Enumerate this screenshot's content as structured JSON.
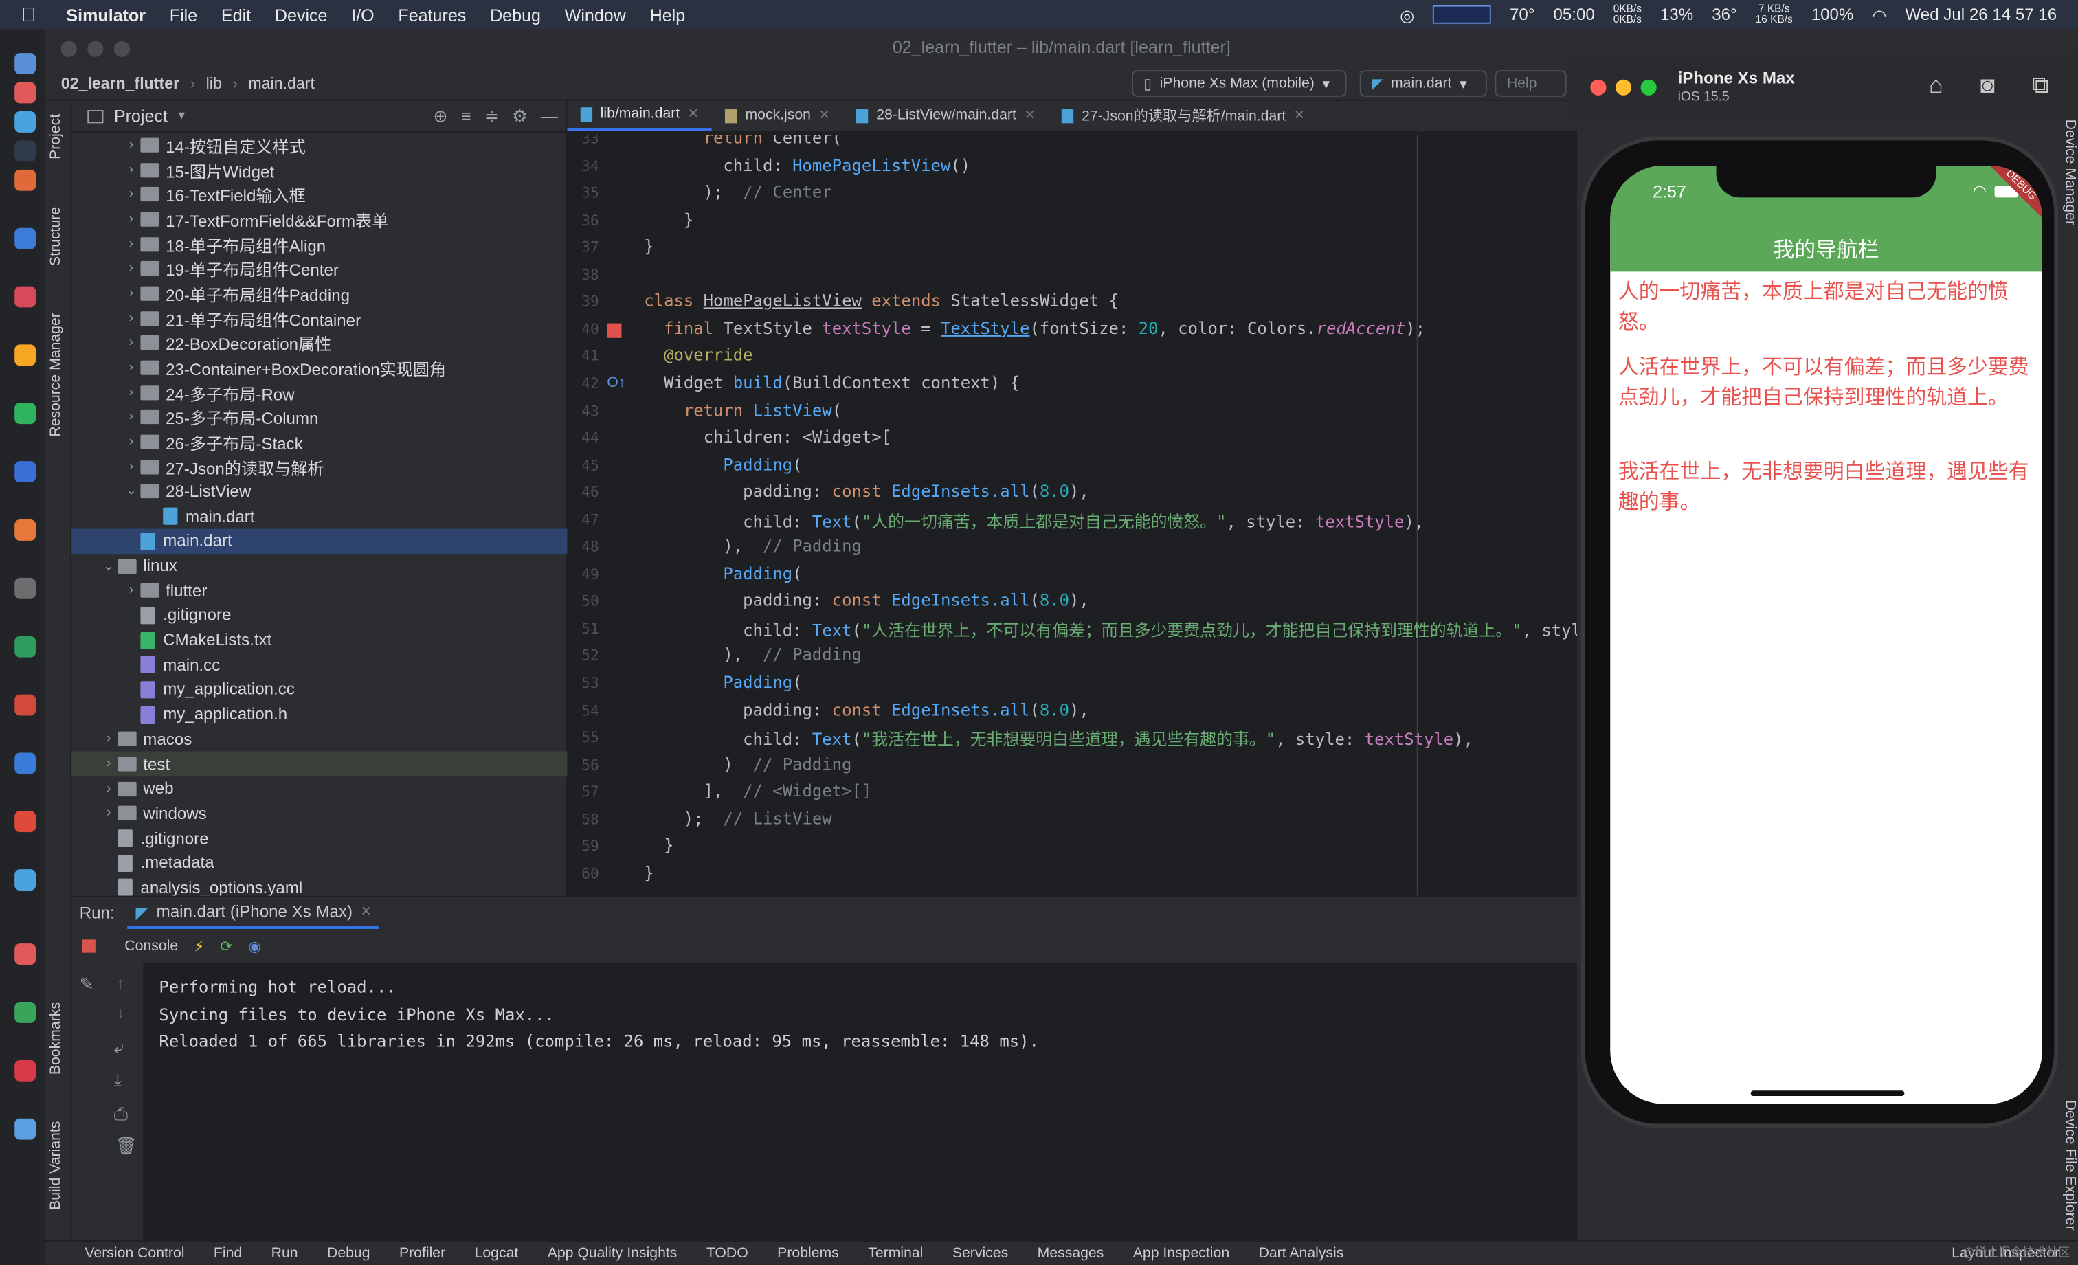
{
  "menubar": {
    "app": "Simulator",
    "items": [
      "File",
      "Edit",
      "Device",
      "I/O",
      "Features",
      "Debug",
      "Window",
      "Help"
    ],
    "weather": "70°",
    "clock_small": "05:00",
    "net_down": "0KB/s",
    "net_up": "0KB/s",
    "cpu": "13%",
    "temp": "36°",
    "net2_down": "7 KB/s",
    "net2_up": "16 KB/s",
    "battery": "100%",
    "datetime": "Wed Jul 26  14 57 16"
  },
  "ide": {
    "window_title": "02_learn_flutter – lib/main.dart [learn_flutter]",
    "breadcrumb": [
      "02_learn_flutter",
      "lib",
      "main.dart"
    ],
    "device_selector": "iPhone Xs Max (mobile)",
    "run_config": "main.dart",
    "help_label": "Help",
    "left_tabs": [
      "Project",
      "Structure",
      "Resource Manager",
      "Bookmarks",
      "Build Variants"
    ]
  },
  "project": {
    "header": "Project",
    "rows": [
      {
        "indent": 2,
        "chev": "›",
        "icon": "folder",
        "label": "14-按钮自定义样式"
      },
      {
        "indent": 2,
        "chev": "›",
        "icon": "folder",
        "label": "15-图片Widget"
      },
      {
        "indent": 2,
        "chev": "›",
        "icon": "folder",
        "label": "16-TextField输入框"
      },
      {
        "indent": 2,
        "chev": "›",
        "icon": "folder",
        "label": "17-TextFormField&&Form表单"
      },
      {
        "indent": 2,
        "chev": "›",
        "icon": "folder",
        "label": "18-单子布局组件Align"
      },
      {
        "indent": 2,
        "chev": "›",
        "icon": "folder",
        "label": "19-单子布局组件Center"
      },
      {
        "indent": 2,
        "chev": "›",
        "icon": "folder",
        "label": "20-单子布局组件Padding"
      },
      {
        "indent": 2,
        "chev": "›",
        "icon": "folder",
        "label": "21-单子布局组件Container"
      },
      {
        "indent": 2,
        "chev": "›",
        "icon": "folder",
        "label": "22-BoxDecoration属性"
      },
      {
        "indent": 2,
        "chev": "›",
        "icon": "folder",
        "label": "23-Container+BoxDecoration实现圆角"
      },
      {
        "indent": 2,
        "chev": "›",
        "icon": "folder",
        "label": "24-多子布局-Row"
      },
      {
        "indent": 2,
        "chev": "›",
        "icon": "folder",
        "label": "25-多子布局-Column"
      },
      {
        "indent": 2,
        "chev": "›",
        "icon": "folder",
        "label": "26-多子布局-Stack"
      },
      {
        "indent": 2,
        "chev": "›",
        "icon": "folder",
        "label": "27-Json的读取与解析"
      },
      {
        "indent": 2,
        "chev": "⌄",
        "icon": "folder",
        "label": "28-ListView"
      },
      {
        "indent": 3,
        "chev": "",
        "icon": "dart",
        "label": "main.dart"
      },
      {
        "indent": 2,
        "chev": "",
        "icon": "dart",
        "label": "main.dart",
        "selected": true
      },
      {
        "indent": 1,
        "chev": "⌄",
        "icon": "folder",
        "label": "linux"
      },
      {
        "indent": 2,
        "chev": "›",
        "icon": "folder",
        "label": "flutter"
      },
      {
        "indent": 2,
        "chev": "",
        "icon": "gen",
        "label": ".gitignore"
      },
      {
        "indent": 2,
        "chev": "",
        "icon": "cm",
        "label": "CMakeLists.txt"
      },
      {
        "indent": 2,
        "chev": "",
        "icon": "cc",
        "label": "main.cc"
      },
      {
        "indent": 2,
        "chev": "",
        "icon": "cc",
        "label": "my_application.cc"
      },
      {
        "indent": 2,
        "chev": "",
        "icon": "cc",
        "label": "my_application.h"
      },
      {
        "indent": 1,
        "chev": "›",
        "icon": "folder",
        "label": "macos"
      },
      {
        "indent": 1,
        "chev": "›",
        "icon": "folder",
        "label": "test",
        "highlight": true
      },
      {
        "indent": 1,
        "chev": "›",
        "icon": "folder",
        "label": "web"
      },
      {
        "indent": 1,
        "chev": "›",
        "icon": "folder",
        "label": "windows"
      },
      {
        "indent": 1,
        "chev": "",
        "icon": "gen",
        "label": ".gitignore"
      },
      {
        "indent": 1,
        "chev": "",
        "icon": "gen",
        "label": ".metadata"
      },
      {
        "indent": 1,
        "chev": "",
        "icon": "gen",
        "label": "analysis_options.yaml"
      }
    ]
  },
  "editor": {
    "tabs": [
      {
        "label": "lib/main.dart",
        "active": true
      },
      {
        "label": "mock.json",
        "active": false
      },
      {
        "label": "28-ListView/main.dart",
        "active": false
      },
      {
        "label": "27-Json的读取与解析/main.dart",
        "active": false
      }
    ],
    "lines": [
      {
        "n": "33",
        "html": "      <span class='kw'>return</span> Center("
      },
      {
        "n": "34",
        "html": "        child: <span class='fn'>HomePageListView</span>()"
      },
      {
        "n": "35",
        "html": "      );  <span class='cm2'>// Center</span>"
      },
      {
        "n": "36",
        "html": "    }"
      },
      {
        "n": "37",
        "html": "}"
      },
      {
        "n": "38",
        "html": ""
      },
      {
        "n": "39",
        "html": "<span class='kw'>class</span> <span class='cls'><u>HomePageListView</u></span> <span class='kw'>extends</span> StatelessWidget {"
      },
      {
        "n": "40",
        "html": "  <span class='kw'>final</span> TextStyle <span class='fld'>textStyle</span> = <span class='fn'><u>TextStyle</u></span>(fontSize: <span class='num'>20</span>, color: Colors.<span class='par'><i>redAccent</i></span>);"
      },
      {
        "n": "41",
        "html": "  <span class='ann'>@override</span>"
      },
      {
        "n": "42",
        "html": "  Widget <span class='fn'>build</span>(BuildContext context) {"
      },
      {
        "n": "43",
        "html": "    <span class='kw'>return</span> <span class='fn'>ListView</span>("
      },
      {
        "n": "44",
        "html": "      children: &lt;Widget&gt;["
      },
      {
        "n": "45",
        "html": "        <span class='fn'>Padding</span>("
      },
      {
        "n": "46",
        "html": "          padding: <span class='kw'>const</span> <span class='fn'>EdgeInsets.all</span>(<span class='num'>8.0</span>),"
      },
      {
        "n": "47",
        "html": "          child: <span class='fn'>Text</span>(<span class='str'>\"人的一切痛苦，本质上都是对自己无能的愤怒。\"</span>, style: <span class='fld'>textStyle</span>),"
      },
      {
        "n": "48",
        "html": "        ),  <span class='cm2'>// Padding</span>"
      },
      {
        "n": "49",
        "html": "        <span class='fn'>Padding</span>("
      },
      {
        "n": "50",
        "html": "          padding: <span class='kw'>const</span> <span class='fn'>EdgeInsets.all</span>(<span class='num'>8.0</span>),"
      },
      {
        "n": "51",
        "html": "          child: <span class='fn'>Text</span>(<span class='str'>\"人活在世界上，不可以有偏差；而且多少要费点劲儿，才能把自己保持到理性的轨道上。\"</span>, style"
      },
      {
        "n": "52",
        "html": "        ),  <span class='cm2'>// Padding</span>"
      },
      {
        "n": "53",
        "html": "        <span class='fn'>Padding</span>("
      },
      {
        "n": "54",
        "html": "          padding: <span class='kw'>const</span> <span class='fn'>EdgeInsets.all</span>(<span class='num'>8.0</span>),"
      },
      {
        "n": "55",
        "html": "          child: <span class='fn'>Text</span>(<span class='str'>\"我活在世上，无非想要明白些道理，遇见些有趣的事。\"</span>, style: <span class='fld'>textStyle</span>),"
      },
      {
        "n": "56",
        "html": "        )  <span class='cm2'>// Padding</span>"
      },
      {
        "n": "57",
        "html": "      ],  <span class='cm2'>// &lt;Widget&gt;[]</span>"
      },
      {
        "n": "58",
        "html": "    );  <span class='cm2'>// ListView</span>"
      },
      {
        "n": "59",
        "html": "  }"
      },
      {
        "n": "60",
        "html": "}"
      }
    ]
  },
  "run": {
    "label": "Run:",
    "tab": "main.dart (iPhone Xs Max)",
    "console_label": "Console",
    "output": [
      "Performing hot reload...",
      "Syncing files to device iPhone Xs Max...",
      "Reloaded 1 of 665 libraries in 292ms (compile: 26 ms, reload: 95 ms, reassemble: 148 ms)."
    ]
  },
  "statusbar": {
    "items": [
      "Version Control",
      "Find",
      "Run",
      "Debug",
      "Profiler",
      "Logcat",
      "App Quality Insights",
      "TODO",
      "Problems",
      "Terminal",
      "Services",
      "Messages",
      "App Inspection",
      "Dart Analysis"
    ],
    "right": "Layout Inspector"
  },
  "simulator": {
    "device": "iPhone Xs Max",
    "os": "iOS 15.5",
    "time": "2:57",
    "debug_banner": "DEBUG",
    "appbar_title": "我的导航栏",
    "texts": [
      "人的一切痛苦，本质上都是对自己无能的愤怒。",
      "人活在世界上，不可以有偏差；而且多少要费点劲儿，才能把自己保持到理性的轨道上。",
      "我活在世上，无非想要明白些道理，遇见些有趣的事。"
    ],
    "colors": {
      "appbar": "#5aa858",
      "text": "#e8534f"
    }
  },
  "right_tabs": [
    "Device Manager",
    "Device File Explorer"
  ],
  "watermark": "@稀土掘金技术社区"
}
